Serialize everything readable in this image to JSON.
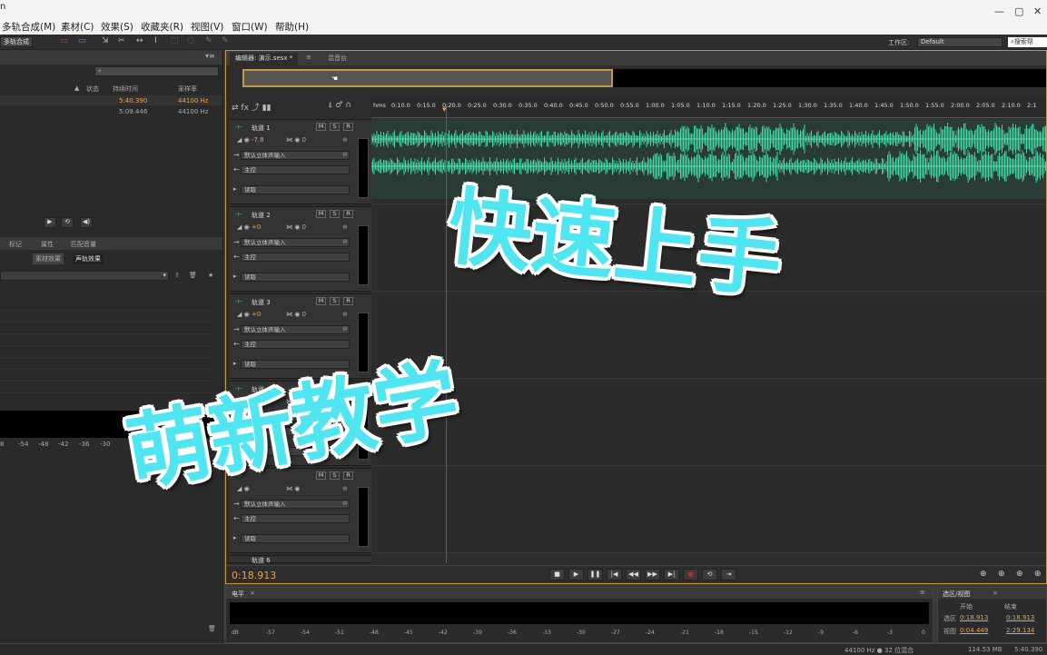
{
  "window": {
    "title_fragment": "n",
    "min": "—",
    "max": "▢",
    "close": "✕"
  },
  "menu": [
    "多轨合成(M)",
    "素材(C)",
    "效果(S)",
    "收藏夹(R)",
    "视图(V)",
    "窗口(W)",
    "帮助(H)"
  ],
  "toolbar": {
    "mode_button": "多轨合成",
    "workspace_label": "工作区:",
    "workspace_value": "Default",
    "search_label": "搜索帮"
  },
  "left_panel": {
    "files_columns": [
      "状态",
      "持续时间",
      "采样率"
    ],
    "files": [
      {
        "duration": "5:40.390",
        "rate": "44100 Hz"
      },
      {
        "duration": "5:09.446",
        "rate": "44100 Hz"
      }
    ],
    "tabs2": [
      "标记",
      "属性",
      "匹配音量"
    ],
    "effect_tabs": [
      "素材效果",
      "声轨效果"
    ],
    "meter_ticks": [
      "8",
      "-54",
      "-48",
      "-42",
      "-36",
      "-30"
    ]
  },
  "editor": {
    "tab_label": "编辑器: 演示.sesx *",
    "tab_menu": "≡",
    "tab2_label": "混音台",
    "ruler": [
      "hms",
      "0:10.0",
      "0:15.0",
      "0:20.0",
      "0:25.0",
      "0:30.0",
      "0:35.0",
      "0:40.0",
      "0:45.0",
      "0:50.0",
      "0:55.0",
      "1:00.0",
      "1:05.0",
      "1:10.0",
      "1:15.0",
      "1:20.0",
      "1:25.0",
      "1:30.0",
      "1:35.0",
      "1:40.0",
      "1:45.0",
      "1:50.0",
      "1:55.0",
      "2:00.0",
      "2:05.0",
      "2:10.0",
      "2:1"
    ],
    "tracks": [
      {
        "name": "轨道 1",
        "vol": "-7.8",
        "pan": "0",
        "input": "默认立体声输入",
        "output": "主控",
        "mode": "读取"
      },
      {
        "name": "轨道 2",
        "vol": "+0",
        "pan": "0",
        "input": "默认立体声输入",
        "output": "主控",
        "mode": "读取"
      },
      {
        "name": "轨道 3",
        "vol": "+0",
        "pan": "0",
        "input": "默认立体声输入",
        "output": "主控",
        "mode": "读取"
      },
      {
        "name": "轨道 4",
        "vol": "+0",
        "pan": "0",
        "input": "",
        "output": "",
        "mode": ""
      },
      {
        "name": "",
        "vol": "",
        "pan": "",
        "input": "默认立体声输入",
        "output": "主控",
        "mode": "读取"
      }
    ],
    "track6": "轨道 6",
    "hsr": [
      "M",
      "S",
      "R"
    ],
    "timecode": "0:18.913"
  },
  "level_panel": {
    "title": "电平",
    "ticks": [
      "dB",
      "-57",
      "-54",
      "-51",
      "-48",
      "-45",
      "-42",
      "-39",
      "-36",
      "-33",
      "-30",
      "-27",
      "-24",
      "-21",
      "-18",
      "-15",
      "-12",
      "-9",
      "-6",
      "-3",
      "0"
    ]
  },
  "selection_view": {
    "title": "选区/视图",
    "col_start": "开始",
    "col_end": "结束",
    "sel_label": "选区",
    "sel_start": "0:18.913",
    "sel_end": "0:18.913",
    "view_label": "视图",
    "view_start": "0:04.449",
    "view_end": "2:29.134"
  },
  "status": {
    "format": "44100 Hz ● 32 位混合",
    "size": "114.53 MB",
    "duration": "5:40.390"
  },
  "overlay": {
    "line1": "快速上手",
    "line2": "萌新教学"
  },
  "colors": {
    "accent": "#c49a3a",
    "waveform": "#3fd6a0",
    "overlay": "#4fe6f2",
    "timecode": "#e8a64a"
  }
}
